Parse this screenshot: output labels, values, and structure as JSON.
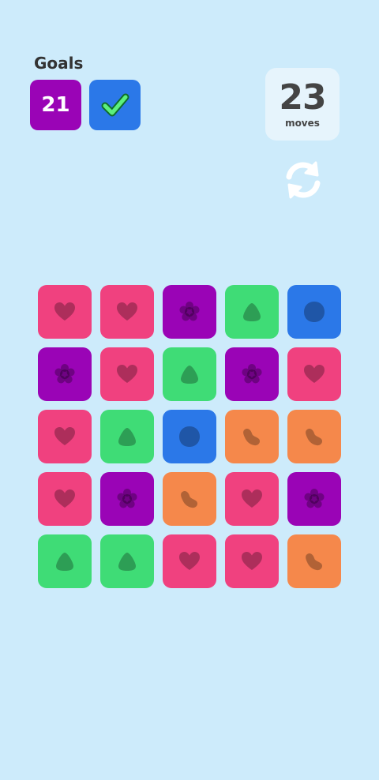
{
  "goals": {
    "title": "Goals",
    "items": [
      {
        "kind": "count",
        "value": "21",
        "color": "#9a04b6"
      },
      {
        "kind": "done",
        "icon": "check-icon",
        "color": "#2b78e8"
      }
    ]
  },
  "moves": {
    "count": "23",
    "label": "moves"
  },
  "reset": {
    "icon": "refresh-icon"
  },
  "colors": {
    "pink": "#f0417f",
    "purple": "#9a04b6",
    "green": "#3fdc76",
    "blue": "#2b78e8",
    "orange": "#f5884b"
  },
  "board": [
    [
      "pink",
      "pink",
      "purple",
      "green",
      "blue"
    ],
    [
      "purple",
      "pink",
      "green",
      "purple",
      "pink"
    ],
    [
      "pink",
      "green",
      "blue",
      "orange",
      "orange"
    ],
    [
      "pink",
      "purple",
      "orange",
      "pink",
      "purple"
    ],
    [
      "green",
      "green",
      "pink",
      "pink",
      "orange"
    ]
  ],
  "shape_icons": {
    "pink": "heart-icon",
    "purple": "flower-icon",
    "green": "drop-icon",
    "blue": "blob-icon",
    "orange": "bean-icon"
  }
}
